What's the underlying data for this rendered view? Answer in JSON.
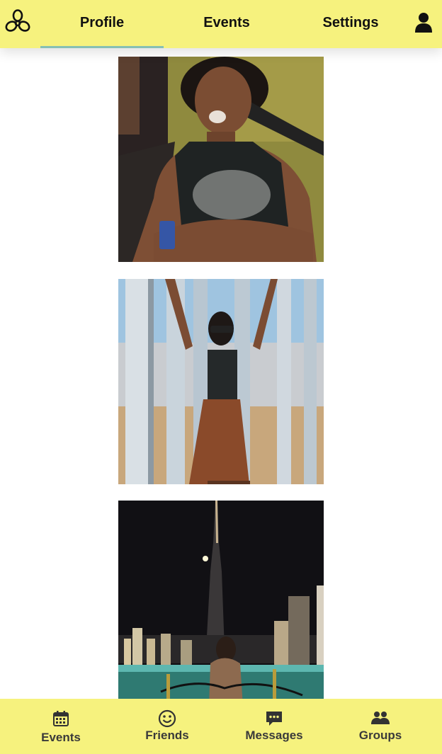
{
  "header": {
    "tabs": [
      {
        "label": "Profile",
        "active": true
      },
      {
        "label": "Events",
        "active": false
      },
      {
        "label": "Settings",
        "active": false
      }
    ],
    "logo_icon": "flower-logo-icon",
    "account_icon": "user-icon"
  },
  "photos": [
    {
      "icon": "photo-woman-on-grass"
    },
    {
      "icon": "photo-mirror-installation"
    },
    {
      "icon": "photo-night-skyline"
    }
  ],
  "bottom_nav": {
    "items": [
      {
        "label": "Events",
        "icon": "calendar-icon"
      },
      {
        "label": "Friends",
        "icon": "smiley-icon"
      },
      {
        "label": "Messages",
        "icon": "chat-bubble-icon"
      },
      {
        "label": "Groups",
        "icon": "group-icon"
      }
    ]
  },
  "colors": {
    "bar_background": "#f6f27e",
    "active_tab_underline": "#86bfb4",
    "text": "#111111",
    "nav_text": "#3a3a3a"
  }
}
